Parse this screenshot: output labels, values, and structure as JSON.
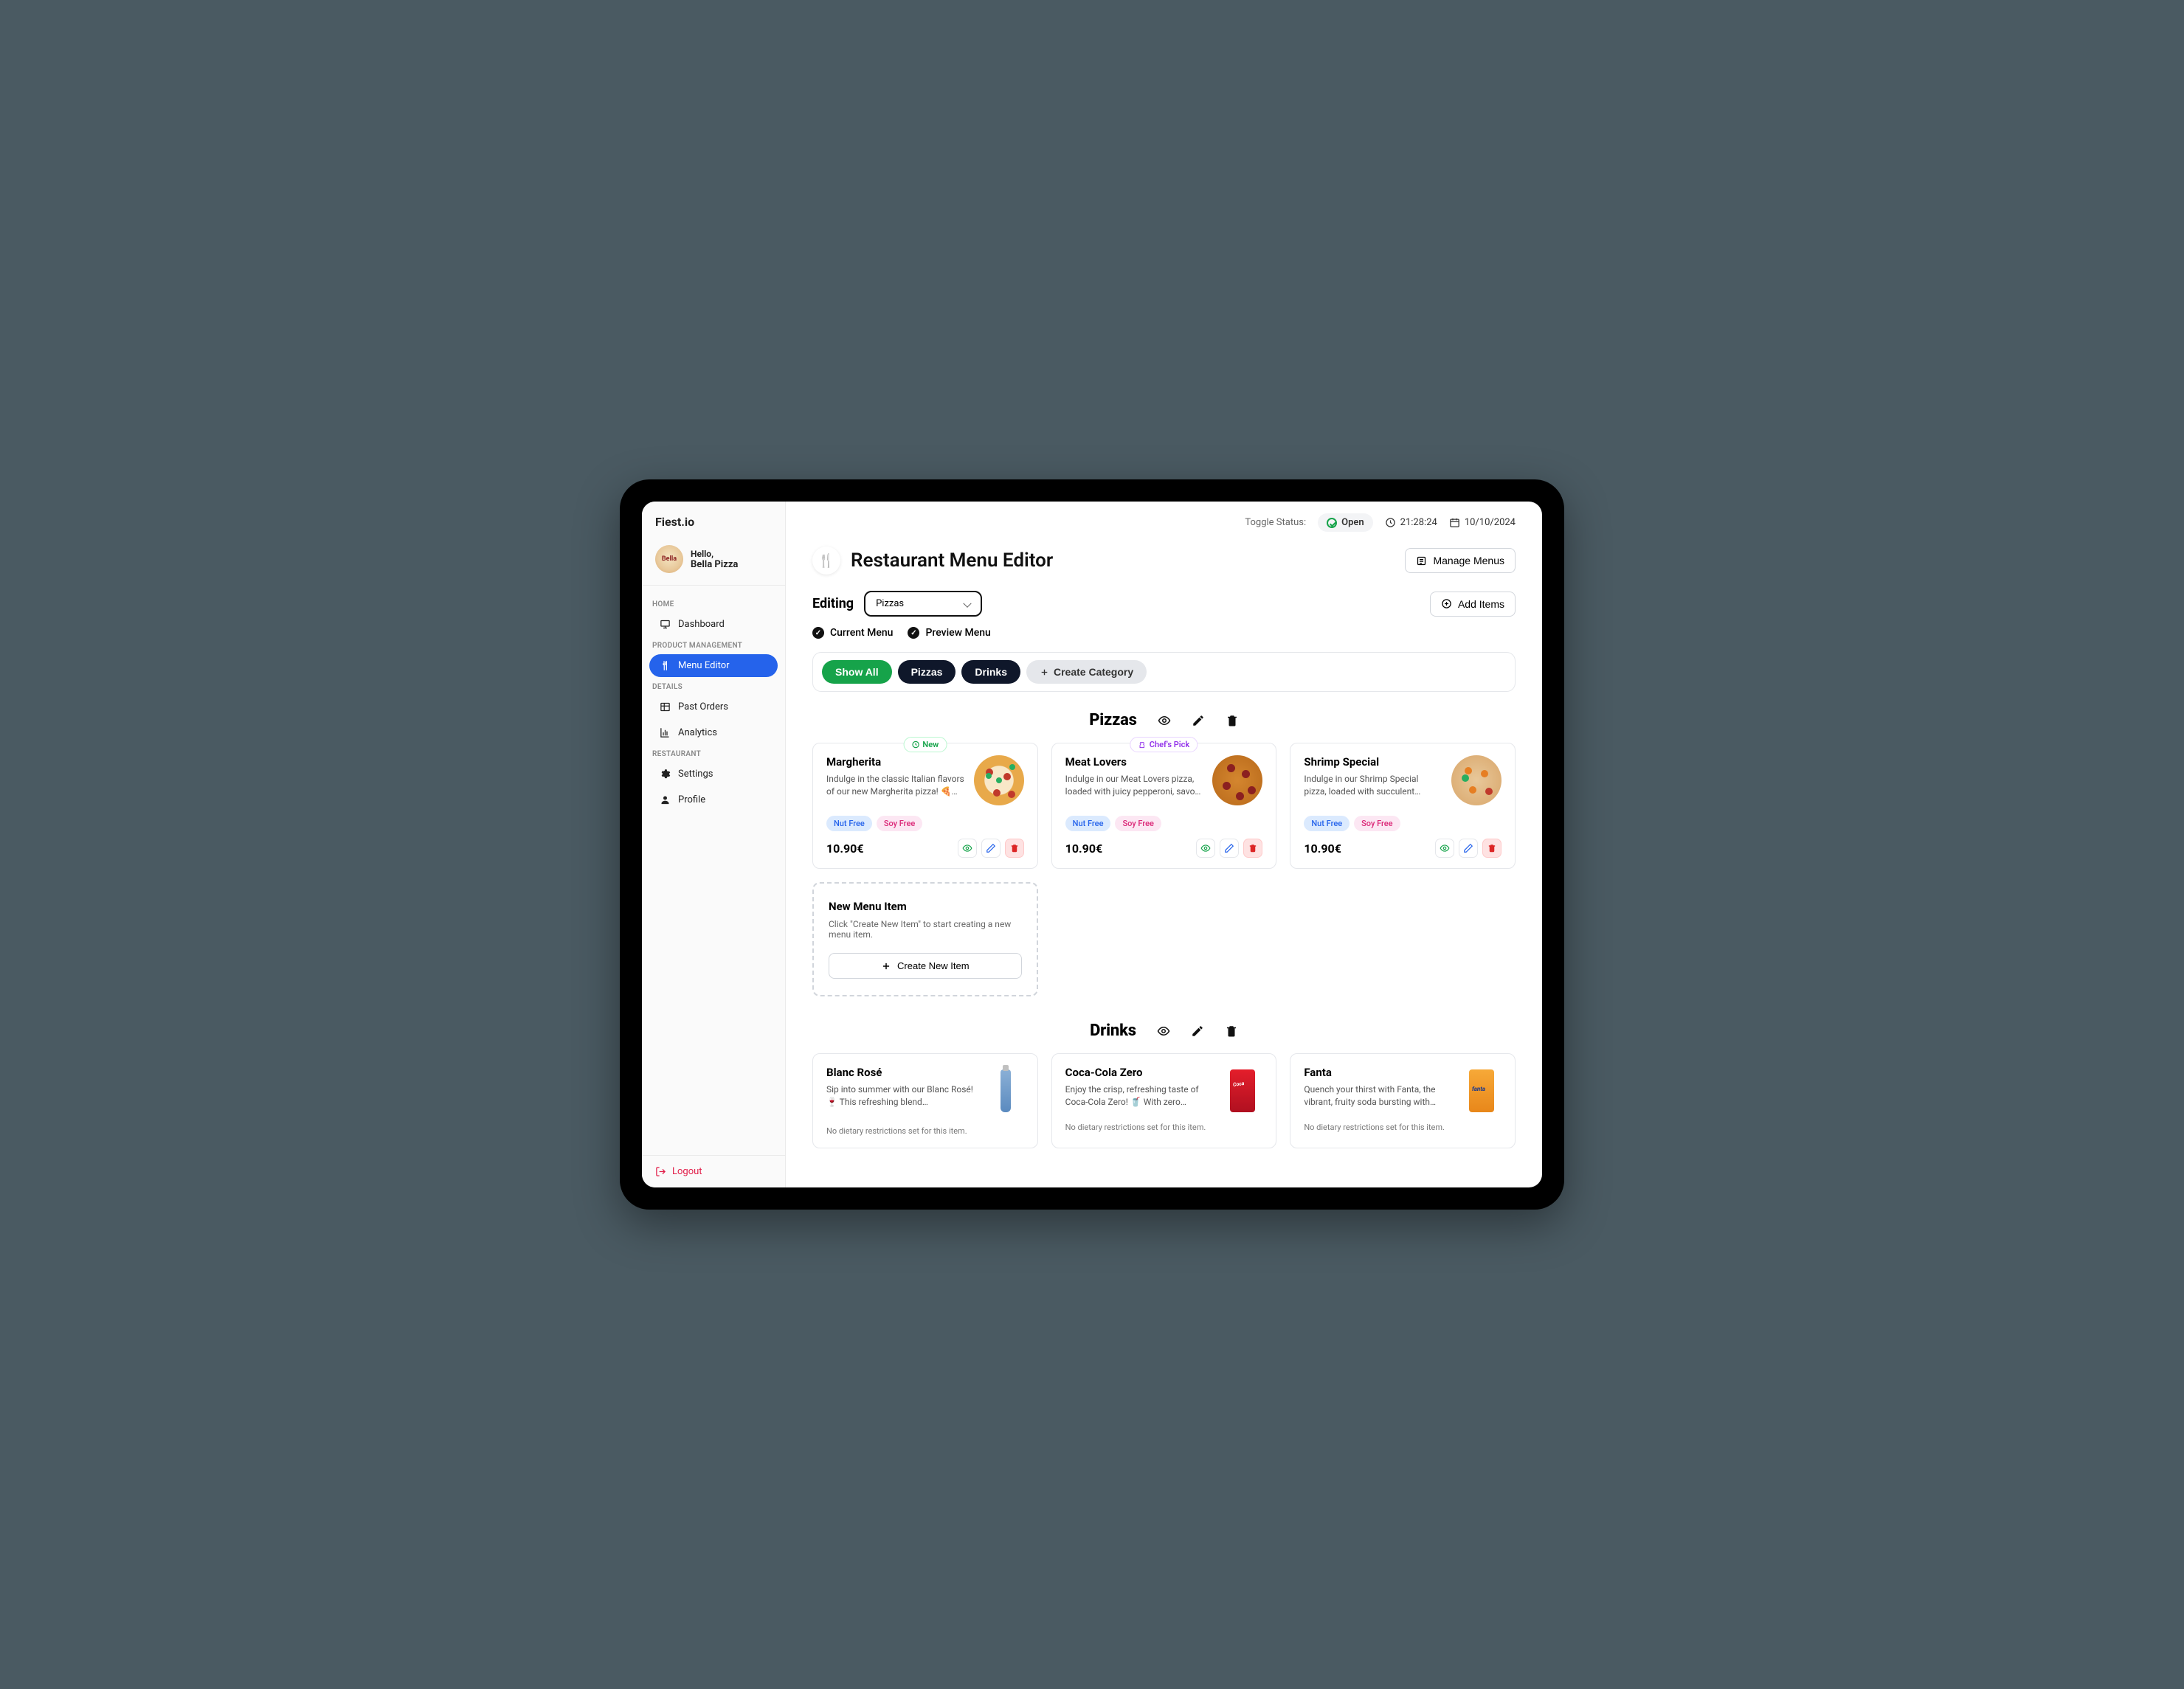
{
  "brand": "Fiest.io",
  "profile": {
    "hello": "Hello,",
    "name": "Bella Pizza",
    "avatar_label": "Bella"
  },
  "nav": {
    "sections": [
      {
        "label": "HOME",
        "items": [
          {
            "key": "dashboard",
            "label": "Dashboard",
            "icon": "monitor"
          }
        ]
      },
      {
        "label": "PRODUCT MANAGEMENT",
        "items": [
          {
            "key": "menu-editor",
            "label": "Menu Editor",
            "icon": "utensils",
            "active": true
          }
        ]
      },
      {
        "label": "DETAILS",
        "items": [
          {
            "key": "past-orders",
            "label": "Past Orders",
            "icon": "table"
          },
          {
            "key": "analytics",
            "label": "Analytics",
            "icon": "chart"
          }
        ]
      },
      {
        "label": "RESTAURANT",
        "items": [
          {
            "key": "settings",
            "label": "Settings",
            "icon": "gear"
          },
          {
            "key": "profile",
            "label": "Profile",
            "icon": "user"
          }
        ]
      }
    ],
    "logout": "Logout"
  },
  "topbar": {
    "toggle_label": "Toggle Status:",
    "status": "Open",
    "time": "21:28:24",
    "date": "10/10/2024"
  },
  "header": {
    "title": "Restaurant Menu Editor",
    "manage_menus": "Manage Menus"
  },
  "editing": {
    "label": "Editing",
    "selected": "Pizzas",
    "add_items": "Add Items",
    "current_menu": "Current Menu",
    "preview_menu": "Preview Menu"
  },
  "filters": {
    "show_all": "Show All",
    "pizzas": "Pizzas",
    "drinks": "Drinks",
    "create_category": "Create Category"
  },
  "sections": [
    {
      "name": "Pizzas",
      "items": [
        {
          "title": "Margherita",
          "desc": "Indulge in the classic Italian flavors of our new Margherita pizza! 🍕…",
          "badge": "New",
          "tags": [
            "Nut Free",
            "Soy Free"
          ],
          "price": "10.90€",
          "img": "pizza1"
        },
        {
          "title": "Meat Lovers",
          "desc": "Indulge in our Meat Lovers pizza, loaded with juicy pepperoni, savo…",
          "badge": "Chef's Pick",
          "tags": [
            "Nut Free",
            "Soy Free"
          ],
          "price": "10.90€",
          "img": "pizza2"
        },
        {
          "title": "Shrimp Special",
          "desc": "Indulge in our Shrimp Special pizza, loaded with succulent…",
          "tags": [
            "Nut Free",
            "Soy Free"
          ],
          "price": "10.90€",
          "img": "pizza3"
        }
      ],
      "new_item": {
        "title": "New Menu Item",
        "desc": "Click \"Create New Item\" to start creating a new menu item.",
        "button": "Create New Item"
      }
    },
    {
      "name": "Drinks",
      "items": [
        {
          "title": "Blanc Rosé",
          "desc": "Sip into summer with our Blanc Rosé! 🍷 This refreshing blend…",
          "diet_none": "No dietary restrictions set for this item.",
          "img": "bottle"
        },
        {
          "title": "Coca-Cola Zero",
          "desc": "Enjoy the crisp, refreshing taste of Coca-Cola Zero! 🥤 With zero…",
          "diet_none": "No dietary restrictions set for this item.",
          "img": "can-red"
        },
        {
          "title": "Fanta",
          "desc": "Quench your thirst with Fanta, the vibrant, fruity soda bursting with…",
          "diet_none": "No dietary restrictions set for this item.",
          "img": "can-orange"
        }
      ]
    }
  ]
}
